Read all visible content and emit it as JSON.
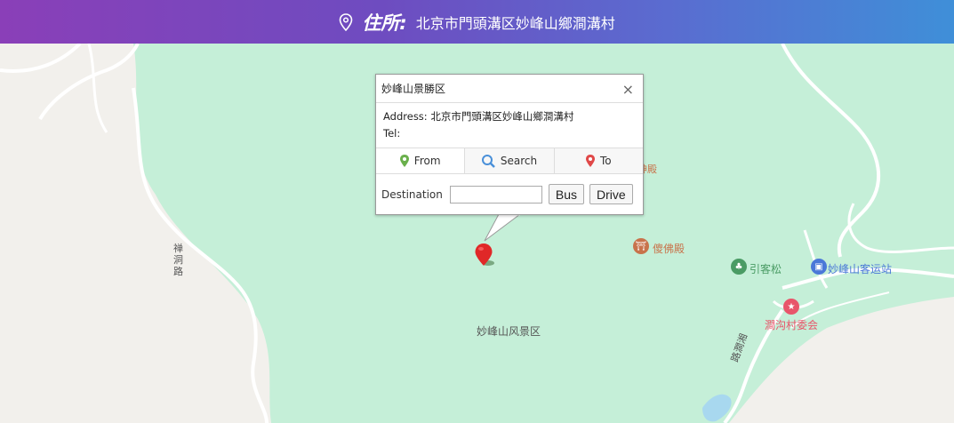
{
  "header": {
    "label": "住所:",
    "address": "北京市門頭溝区妙峰山鄉澗溝村"
  },
  "popup": {
    "title": "妙峰山景勝区",
    "close": "×",
    "address_label": "Address:",
    "address_value": "北京市門頭溝区妙峰山鄉澗溝村",
    "tel_label": "Tel:",
    "tel_value": "",
    "tabs": [
      {
        "label": "From",
        "icon": "green-pin-icon"
      },
      {
        "label": "Search",
        "icon": "magnifier-icon"
      },
      {
        "label": "To",
        "icon": "red-pin-icon"
      }
    ],
    "destination_label": "Destination",
    "destination_value": "",
    "bus_label": "Bus",
    "drive_label": "Drive"
  },
  "map": {
    "labels": {
      "road_left": "禅\n洞\n路",
      "temple_partial": "神殿",
      "temple": "傻佛殿",
      "pine": "引客松",
      "bus_station": "妙峰山客运站",
      "village_committee": "澗沟村委会",
      "scenic_area": "妙峰山风景区",
      "road_right": "路澗湘"
    },
    "colors": {
      "park": "#c5efd8",
      "land": "#f2f0ec",
      "road": "#ffffff",
      "water": "#a8d8ef",
      "poi_brown": "#c8734b",
      "poi_green": "#4a9b64",
      "poi_blue": "#4a78d8",
      "poi_red": "#e8556a"
    }
  }
}
